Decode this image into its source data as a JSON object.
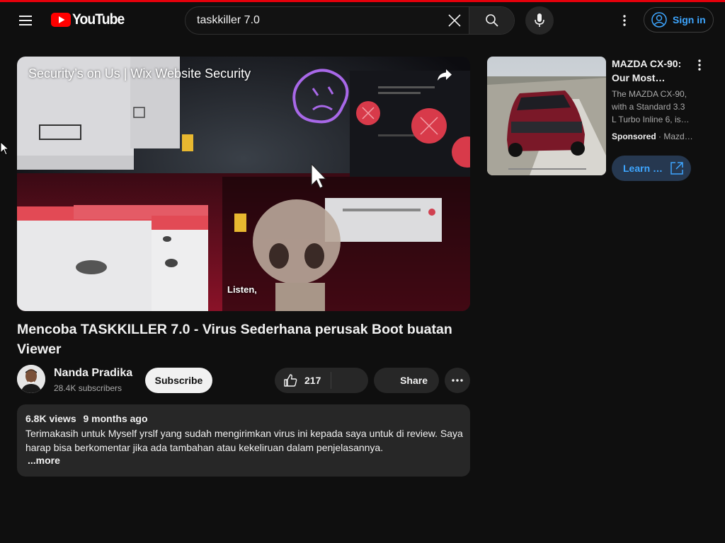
{
  "header": {
    "logo_text": "YouTube",
    "search_value": "taskkiller 7.0",
    "signin_label": "Sign in"
  },
  "player": {
    "overlay_title": "Security’s on Us | Wix Website Security",
    "caption": "Listen,"
  },
  "video": {
    "title": "Mencoba TASKKILLER 7.0 - Virus Sederhana perusak Boot buatan Viewer",
    "channel_name": "Nanda Pradika",
    "subscribers": "28.4K subscribers",
    "subscribe_label": "Subscribe",
    "like_count": "217",
    "share_label": "Share"
  },
  "description": {
    "views": "6.8K views",
    "age": "9 months ago",
    "text": "Terimakasih untuk Myself yrslf yang sudah mengirimkan virus ini kepada saya untuk di review. Saya harap bisa berkomentar jika ada tambahan atau kekeliruan dalam penjelasannya.",
    "more_label": "...more"
  },
  "ad": {
    "title": "MAZDA CX-90: Our Most…",
    "text": "The MAZDA CX-90, with a Standard 3.3 L Turbo Inline 6, is…",
    "sponsored": "Sponsored",
    "advertiser": "Mazd…",
    "learn_label": "Learn …"
  },
  "colors": {
    "background": "#0f0f0f",
    "accent_red": "#ff0000",
    "link_blue": "#3ea6ff",
    "chip": "#272727"
  },
  "icons": [
    "menu-icon",
    "youtube-logo-icon",
    "clear-icon",
    "search-icon",
    "mic-icon",
    "more-vert-icon",
    "account-icon",
    "share-arrow-icon",
    "thumb-up-icon",
    "open-external-icon"
  ]
}
